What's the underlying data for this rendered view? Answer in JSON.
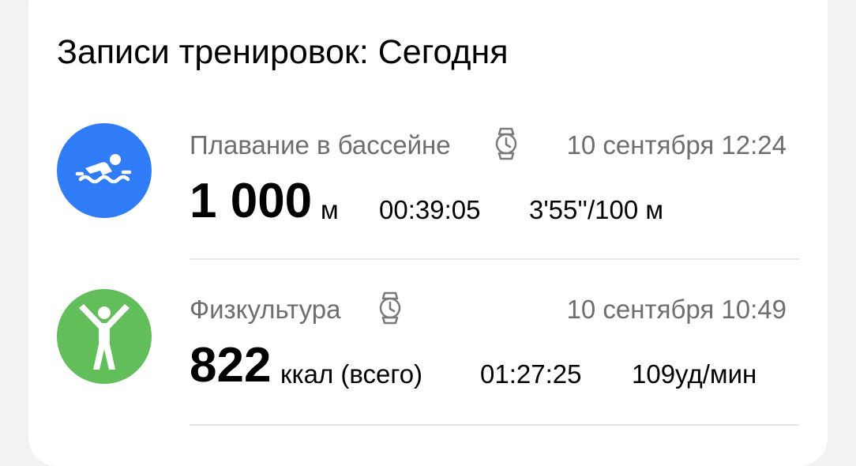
{
  "card": {
    "title": "Записи тренировок: Сегодня"
  },
  "workouts": [
    {
      "icon": "swimmer-icon",
      "icon_color": "#2f7cf6",
      "name": "Плавание в бассейне",
      "device_icon": "smartwatch-icon",
      "date": "10 сентября 12:24",
      "main_value": "1 000",
      "main_unit": "м",
      "duration": "00:39:05",
      "extra": "3'55''/100 м"
    },
    {
      "icon": "exercise-person-icon",
      "icon_color": "#62bd5b",
      "name": "Физкультура",
      "device_icon": "smartwatch-icon",
      "date": "10 сентября 10:49",
      "main_value": "822",
      "main_unit": "ккал (всего)",
      "duration": "01:27:25",
      "extra": "109уд/мин"
    }
  ]
}
